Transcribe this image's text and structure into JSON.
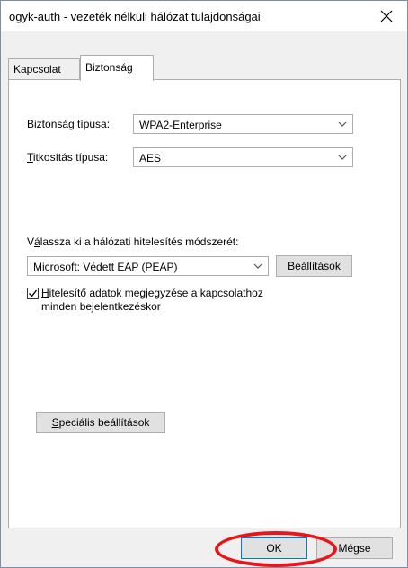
{
  "window": {
    "title": "ogyk-auth - vezeték nélküli hálózat tulajdonságai"
  },
  "tabs": [
    {
      "label": "Kapcsolat",
      "active": false
    },
    {
      "label": "Biztonság",
      "active": true
    }
  ],
  "security": {
    "security_type_label_ul": "B",
    "security_type_label_rest": "iztonság típusa:",
    "security_type_value": "WPA2-Enterprise",
    "encryption_type_label_ul": "T",
    "encryption_type_label_rest": "itkosítás típusa:",
    "encryption_type_value": "AES",
    "auth_method_label_pre": "V",
    "auth_method_label_ul": "á",
    "auth_method_label_rest": "lassza ki a hálózati hitelesítés módszerét:",
    "auth_method_value": "Microsoft: Védett EAP (PEAP)",
    "settings_button_pre": "Be",
    "settings_button_ul": "á",
    "settings_button_rest": "llítások",
    "remember_checkbox_checked": true,
    "remember_line1_ul": "H",
    "remember_line1_rest": "itelesítő adatok megjegyzése a kapcsolathoz",
    "remember_line2": "minden bejelentkezéskor",
    "advanced_button_ul": "S",
    "advanced_button_rest": "peciális beállítások"
  },
  "footer": {
    "ok_label": "OK",
    "cancel_label": "Mégse"
  },
  "colors": {
    "highlight": "#e8151b",
    "default_button_border": "#0078d7"
  }
}
